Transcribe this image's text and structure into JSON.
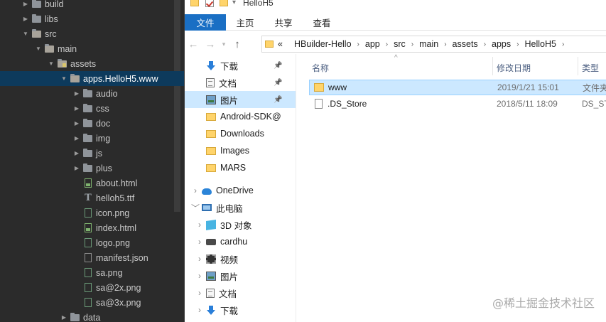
{
  "ide_tree": [
    {
      "label": "build",
      "depth": 0,
      "kind": "folder",
      "expanded": false
    },
    {
      "label": "libs",
      "depth": 0,
      "kind": "folder",
      "expanded": false
    },
    {
      "label": "src",
      "depth": 0,
      "kind": "folder",
      "expanded": true
    },
    {
      "label": "main",
      "depth": 1,
      "kind": "folder",
      "expanded": true
    },
    {
      "label": "assets",
      "depth": 2,
      "kind": "folder",
      "expanded": true,
      "marked": true
    },
    {
      "label": "apps.HelloH5.www",
      "depth": 3,
      "kind": "folder",
      "expanded": true,
      "selected": true
    },
    {
      "label": "audio",
      "depth": 4,
      "kind": "folder",
      "expanded": false
    },
    {
      "label": "css",
      "depth": 4,
      "kind": "folder",
      "expanded": false
    },
    {
      "label": "doc",
      "depth": 4,
      "kind": "folder",
      "expanded": false
    },
    {
      "label": "img",
      "depth": 4,
      "kind": "folder",
      "expanded": false
    },
    {
      "label": "js",
      "depth": 4,
      "kind": "folder",
      "expanded": false
    },
    {
      "label": "plus",
      "depth": 4,
      "kind": "folder",
      "expanded": false
    },
    {
      "label": "about.html",
      "depth": 4,
      "kind": "html"
    },
    {
      "label": "helloh5.ttf",
      "depth": 4,
      "kind": "font"
    },
    {
      "label": "icon.png",
      "depth": 4,
      "kind": "img"
    },
    {
      "label": "index.html",
      "depth": 4,
      "kind": "html"
    },
    {
      "label": "logo.png",
      "depth": 4,
      "kind": "img"
    },
    {
      "label": "manifest.json",
      "depth": 4,
      "kind": "json"
    },
    {
      "label": "sa.png",
      "depth": 4,
      "kind": "img"
    },
    {
      "label": "sa@2x.png",
      "depth": 4,
      "kind": "img"
    },
    {
      "label": "sa@3x.png",
      "depth": 4,
      "kind": "img"
    },
    {
      "label": "data",
      "depth": 3,
      "kind": "folder",
      "expanded": false
    }
  ],
  "explorer": {
    "title": "HelloH5",
    "ribbon_tabs": [
      "文件",
      "主页",
      "共享",
      "查看"
    ],
    "breadcrumb_prefix": "«",
    "breadcrumb": [
      "HBuilder-Hello",
      "app",
      "src",
      "main",
      "assets",
      "apps",
      "HelloH5"
    ],
    "nav_items": [
      {
        "label": "下载",
        "icon": "download-icon",
        "pinned": true,
        "indent": 1
      },
      {
        "label": "文档",
        "icon": "document-icon",
        "pinned": true,
        "indent": 1
      },
      {
        "label": "图片",
        "icon": "picture-icon",
        "pinned": true,
        "indent": 1,
        "selected": true
      },
      {
        "label": "Android-SDK@",
        "icon": "folder-icon",
        "indent": 1
      },
      {
        "label": "Downloads",
        "icon": "folder-icon",
        "indent": 1
      },
      {
        "label": "Images",
        "icon": "folder-icon",
        "indent": 1
      },
      {
        "label": "MARS",
        "icon": "folder-icon",
        "indent": 1
      },
      {
        "label": "OneDrive",
        "icon": "onedrive-icon",
        "expander": ">",
        "indent": 0,
        "gap_before": true
      },
      {
        "label": "此电脑",
        "icon": "computer-icon",
        "expander": "v",
        "indent": 0
      },
      {
        "label": "3D 对象",
        "icon": "3d-objects-icon",
        "expander": ">",
        "indent": 1
      },
      {
        "label": "cardhu",
        "icon": "drive-icon",
        "expander": ">",
        "indent": 1
      },
      {
        "label": "视频",
        "icon": "video-icon",
        "expander": ">",
        "indent": 1
      },
      {
        "label": "图片",
        "icon": "picture-icon",
        "expander": ">",
        "indent": 1
      },
      {
        "label": "文档",
        "icon": "document-icon",
        "expander": ">",
        "indent": 1
      },
      {
        "label": "下载",
        "icon": "download-icon",
        "expander": ">",
        "indent": 1
      }
    ],
    "columns": {
      "name": "名称",
      "modified": "修改日期",
      "type": "类型"
    },
    "files": [
      {
        "name": "www",
        "modified": "2019/1/21 15:01",
        "type": "文件夹",
        "kind": "folder",
        "selected": true
      },
      {
        "name": ".DS_Store",
        "modified": "2018/5/11 18:09",
        "type": "DS_STORE",
        "kind": "file"
      }
    ]
  },
  "watermark": "@稀土掘金技术社区"
}
